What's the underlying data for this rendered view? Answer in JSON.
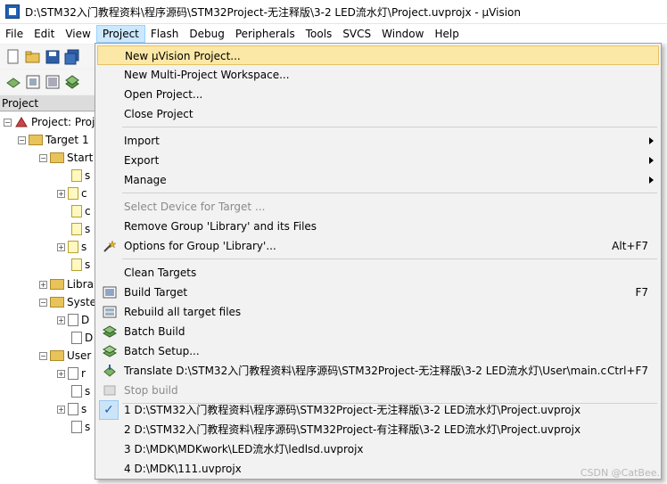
{
  "window": {
    "title": "D:\\STM32入门教程资料\\程序源码\\STM32Project-无注释版\\3-2 LED流水灯\\Project.uvprojx - µVision"
  },
  "menubar": {
    "items": [
      "File",
      "Edit",
      "View",
      "Project",
      "Flash",
      "Debug",
      "Peripherals",
      "Tools",
      "SVCS",
      "Window",
      "Help"
    ],
    "active": "Project"
  },
  "project_panel": {
    "header": "Project",
    "tree": [
      "Project: Proj",
      "Target 1",
      "Start",
      "s",
      "c",
      "c",
      "s",
      "s",
      "s",
      "Libra",
      "Syste",
      "D",
      "D",
      "User",
      "r",
      "s",
      "s",
      "s"
    ]
  },
  "project_menu": {
    "new_project": "New µVision Project...",
    "new_multi": "New Multi-Project Workspace...",
    "open_project": "Open Project...",
    "close_project": "Close Project",
    "import": "Import",
    "export": "Export",
    "manage": "Manage",
    "select_device": "Select Device for Target ...",
    "remove_group": "Remove Group 'Library' and its Files",
    "options_group": "Options for Group 'Library'...",
    "options_group_shortcut": "Alt+F7",
    "clean_targets": "Clean Targets",
    "build_target": "Build Target",
    "build_target_shortcut": "F7",
    "rebuild_all": "Rebuild all target files",
    "batch_build": "Batch Build",
    "batch_setup": "Batch Setup...",
    "translate": "Translate D:\\STM32入门教程资料\\程序源码\\STM32Project-无注释版\\3-2 LED流水灯\\User\\main.c",
    "translate_shortcut": "Ctrl+F7",
    "stop_build": "Stop build",
    "recent_1": "1 D:\\STM32入门教程资料\\程序源码\\STM32Project-无注释版\\3-2 LED流水灯\\Project.uvprojx",
    "recent_2": "2 D:\\STM32入门教程资料\\程序源码\\STM32Project-有注释版\\3-2 LED流水灯\\Project.uvprojx",
    "recent_3": "3 D:\\MDK\\MDKwork\\LED流水灯\\ledlsd.uvprojx",
    "recent_4": "4 D:\\MDK\\111.uvprojx"
  },
  "watermark": "CSDN @CatBee."
}
